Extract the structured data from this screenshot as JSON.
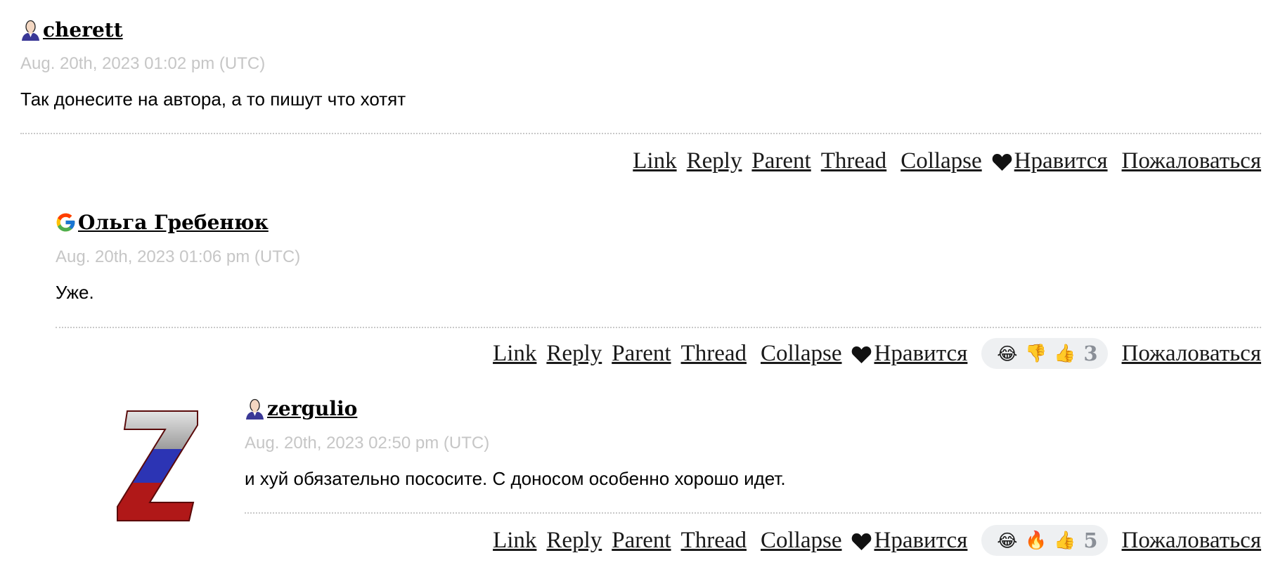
{
  "comments": [
    {
      "username": "cherett",
      "user_icon": "person-icon",
      "timestamp": "Aug. 20th, 2023 01:02 pm (UTC)",
      "text": "Так донесите на автора, а то пишут что хотят",
      "actions": {
        "link": "Link",
        "reply": "Reply",
        "parent": "Parent",
        "thread": "Thread",
        "collapse": "Collapse",
        "like": "Нравится",
        "report": "Пожаловаться"
      }
    },
    {
      "username": "Ольга Гребенюк",
      "user_icon": "google-icon",
      "timestamp": "Aug. 20th, 2023 01:06 pm (UTC)",
      "text": "Уже.",
      "actions": {
        "link": "Link",
        "reply": "Reply",
        "parent": "Parent",
        "thread": "Thread",
        "collapse": "Collapse",
        "like": "Нравится",
        "report": "Пожаловаться"
      },
      "reactions": {
        "emojis": [
          "😂",
          "👎",
          "👍"
        ],
        "count": "3"
      }
    },
    {
      "username": "zergulio",
      "user_icon": "person-icon",
      "avatar": "z-letter-avatar",
      "timestamp": "Aug. 20th, 2023 02:50 pm (UTC)",
      "text": "и хуй обязательно пососите. С доносом особенно хорошо идет.",
      "actions": {
        "link": "Link",
        "reply": "Reply",
        "parent": "Parent",
        "thread": "Thread",
        "collapse": "Collapse",
        "like": "Нравится",
        "report": "Пожаловаться"
      },
      "reactions": {
        "emojis": [
          "😂",
          "🔥",
          "👍"
        ],
        "count": "5"
      }
    }
  ],
  "colors": {
    "timestamp": "#c6c6c6",
    "divider": "#c9c9c9",
    "reaction_bg": "#eef0f2",
    "reaction_count": "#8a8f97"
  }
}
